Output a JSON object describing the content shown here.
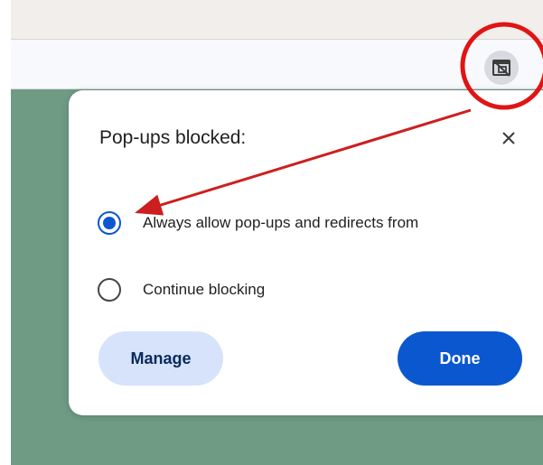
{
  "dialog": {
    "title": "Pop-ups blocked:",
    "options": [
      {
        "label": "Always allow pop-ups and redirects from",
        "selected": true
      },
      {
        "label": "Continue blocking",
        "selected": false
      }
    ],
    "manage_label": "Manage",
    "done_label": "Done"
  },
  "icons": {
    "toolbar": "popup-blocked-icon",
    "close": "close-icon"
  },
  "colors": {
    "accent": "#0b57d0",
    "manage_bg": "#d6e3fb",
    "annotation": "#cc1f1f",
    "page_bg": "#6f9b84"
  }
}
